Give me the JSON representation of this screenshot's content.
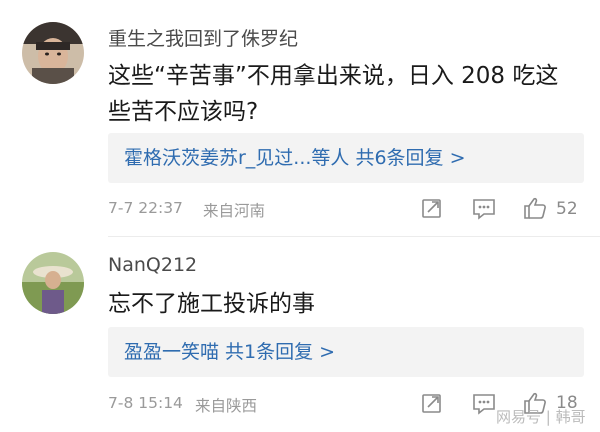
{
  "comments": [
    {
      "username": "重生之我回到了侏罗纪",
      "text_line1": "这些“辛苦事”不用拿出来说，日入 208 吃这",
      "text_line2": "些苦不应该吗?",
      "reply_summary": "霍格沃茨姜苏r_见过...等人  共6条回复 >",
      "date": "7-7 22:37",
      "location": "来自河南",
      "like_count": "52"
    },
    {
      "username": "NanQ212",
      "text_line1": "忘不了施工投诉的事",
      "reply_summary": "盈盈一笑喵  共1条回复 >",
      "date": "7-8 15:14",
      "location": "来自陕西",
      "like_count": "18"
    }
  ],
  "watermark": "网易号 | 韩哥",
  "colors": {
    "link": "#2f6cb0",
    "reply_bg": "#f3f3f3",
    "meta": "#9a9a9a"
  },
  "icons": [
    "share-icon",
    "comment-icon",
    "like-icon"
  ]
}
